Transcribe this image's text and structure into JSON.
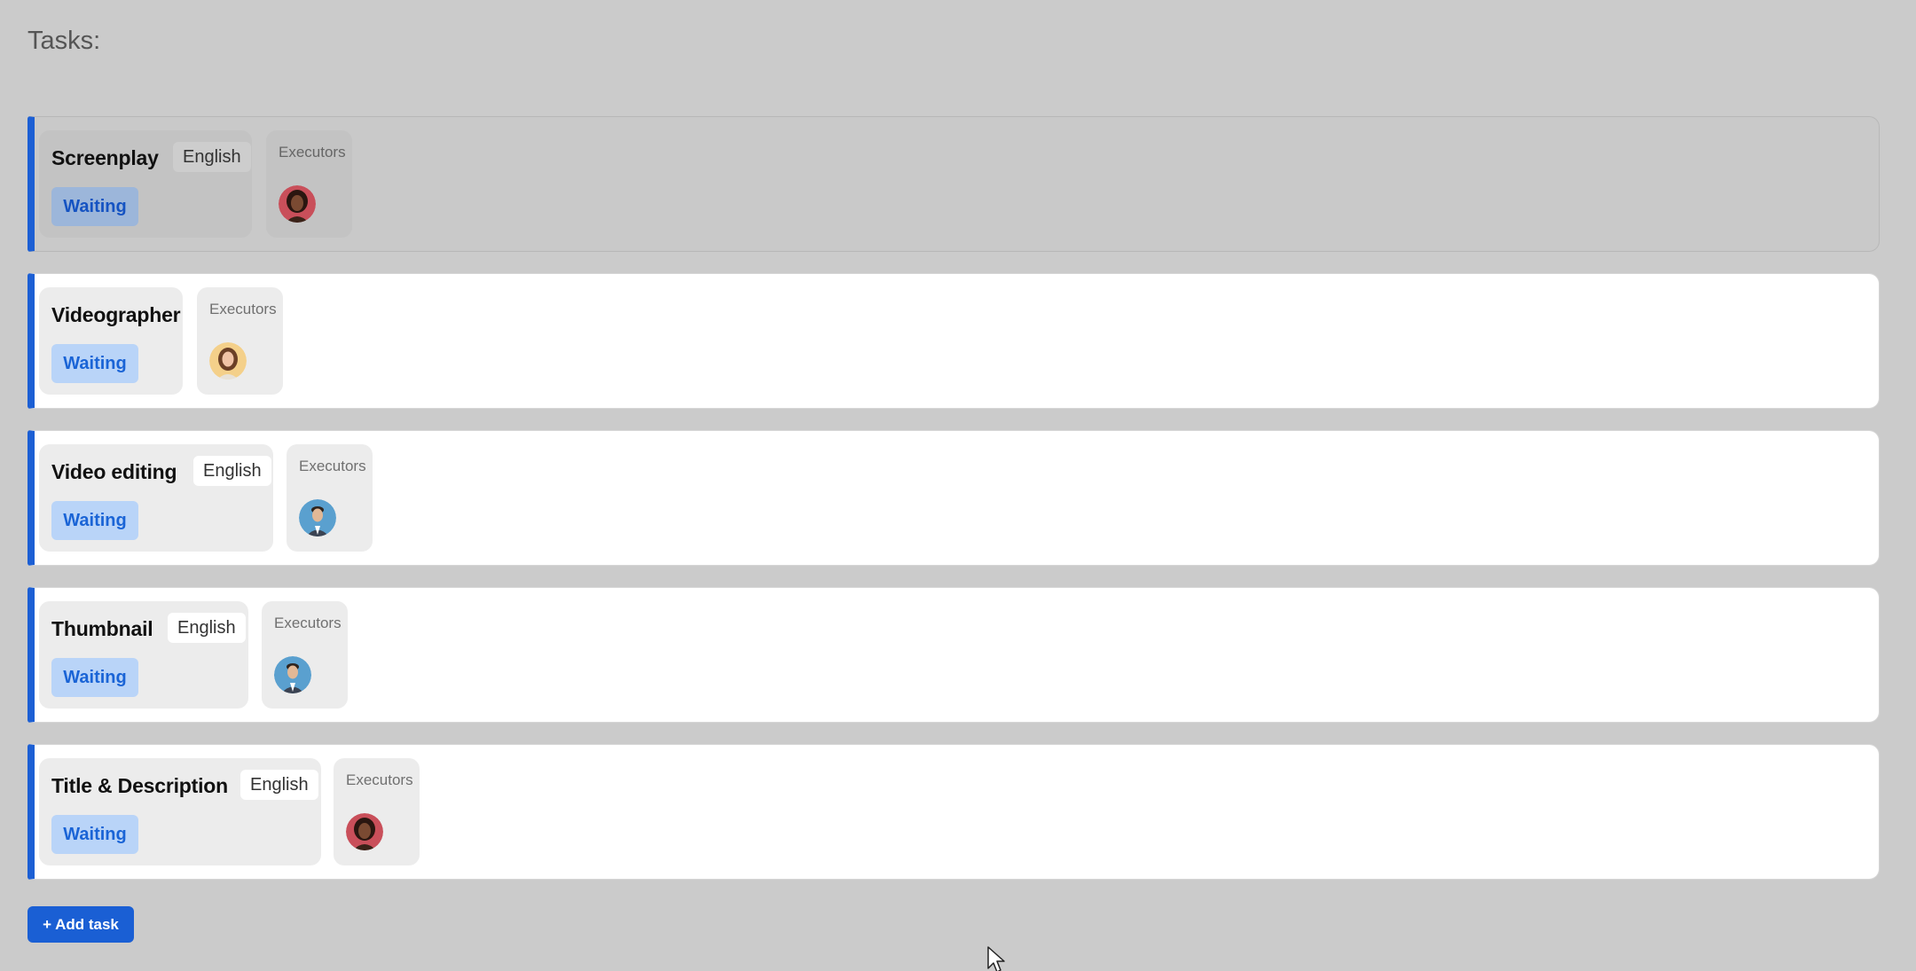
{
  "page": {
    "title": "Tasks:"
  },
  "tasks": [
    {
      "name": "Screenplay",
      "language": "English",
      "status": "Waiting",
      "executors_label": "Executors",
      "executor": "avatar-woman-dark-hair"
    },
    {
      "name": "Videographer",
      "language": "",
      "status": "Waiting",
      "executors_label": "Executors",
      "executor": "avatar-woman-light-hair"
    },
    {
      "name": "Video editing",
      "language": "English",
      "status": "Waiting",
      "executors_label": "Executors",
      "executor": "avatar-man-suit"
    },
    {
      "name": "Thumbnail",
      "language": "English",
      "status": "Waiting",
      "executors_label": "Executors",
      "executor": "avatar-man-suit"
    },
    {
      "name": "Title & Description",
      "language": "English",
      "status": "Waiting",
      "executors_label": "Executors",
      "executor": "avatar-woman-dark-hair"
    }
  ],
  "add_task_label": "+ Add task",
  "colors": {
    "accent": "#1a5fd4",
    "status_bg": "#b9d4f8",
    "status_text": "#1a64d6",
    "page_bg": "#cbcbcb"
  }
}
